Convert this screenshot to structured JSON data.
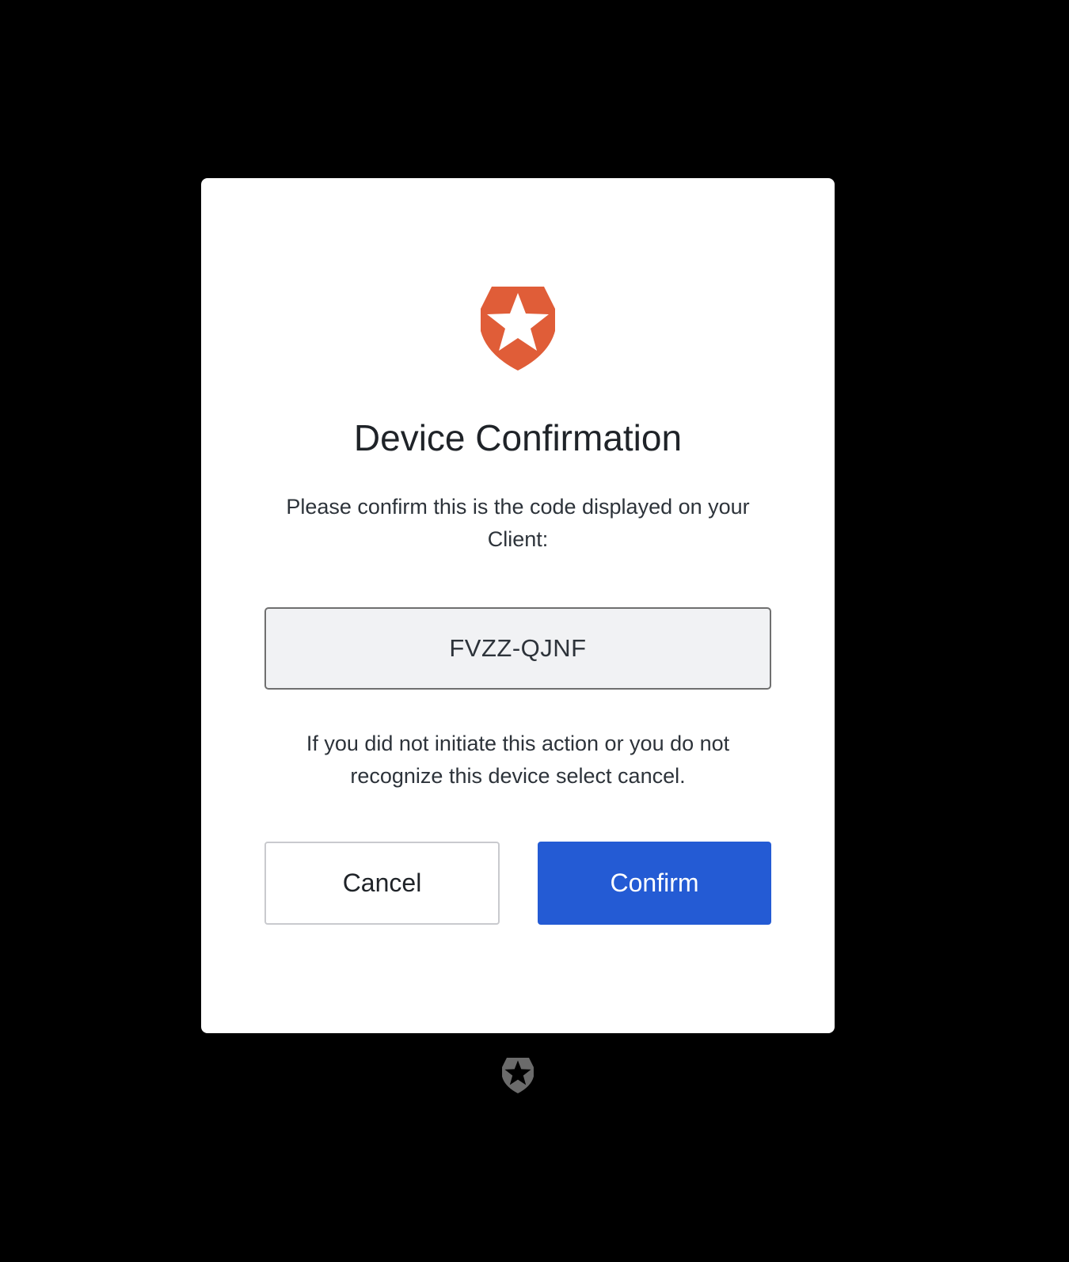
{
  "dialog": {
    "title": "Device Confirmation",
    "instruction": "Please confirm this is the code displayed on your Client:",
    "code": "FVZZ-QJNF",
    "warning": "If you did not initiate this action or you do not recognize this device select cancel.",
    "cancel_label": "Cancel",
    "confirm_label": "Confirm"
  },
  "icons": {
    "brand_logo": "shield-star-icon",
    "footer_logo": "shield-star-icon"
  },
  "colors": {
    "background": "#000000",
    "card": "#ffffff",
    "brand": "#e05d38",
    "confirm_button": "#245bd4",
    "code_box_fill": "#f1f2f4",
    "footer_logo": "#6b6b6b"
  }
}
